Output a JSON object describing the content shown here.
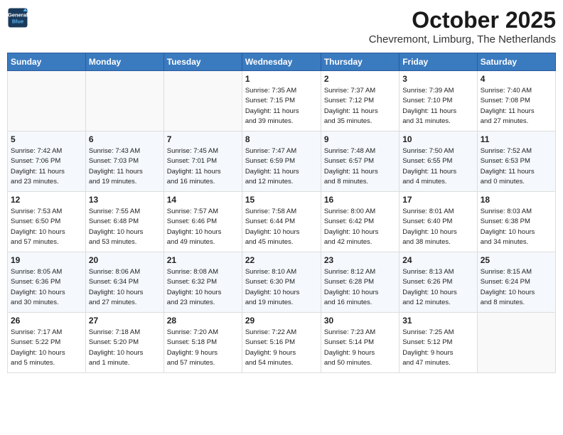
{
  "header": {
    "logo_line1": "General",
    "logo_line2": "Blue",
    "title": "October 2025",
    "subtitle": "Chevremont, Limburg, The Netherlands"
  },
  "weekdays": [
    "Sunday",
    "Monday",
    "Tuesday",
    "Wednesday",
    "Thursday",
    "Friday",
    "Saturday"
  ],
  "weeks": [
    [
      {
        "day": "",
        "info": ""
      },
      {
        "day": "",
        "info": ""
      },
      {
        "day": "",
        "info": ""
      },
      {
        "day": "1",
        "info": "Sunrise: 7:35 AM\nSunset: 7:15 PM\nDaylight: 11 hours\nand 39 minutes."
      },
      {
        "day": "2",
        "info": "Sunrise: 7:37 AM\nSunset: 7:12 PM\nDaylight: 11 hours\nand 35 minutes."
      },
      {
        "day": "3",
        "info": "Sunrise: 7:39 AM\nSunset: 7:10 PM\nDaylight: 11 hours\nand 31 minutes."
      },
      {
        "day": "4",
        "info": "Sunrise: 7:40 AM\nSunset: 7:08 PM\nDaylight: 11 hours\nand 27 minutes."
      }
    ],
    [
      {
        "day": "5",
        "info": "Sunrise: 7:42 AM\nSunset: 7:06 PM\nDaylight: 11 hours\nand 23 minutes."
      },
      {
        "day": "6",
        "info": "Sunrise: 7:43 AM\nSunset: 7:03 PM\nDaylight: 11 hours\nand 19 minutes."
      },
      {
        "day": "7",
        "info": "Sunrise: 7:45 AM\nSunset: 7:01 PM\nDaylight: 11 hours\nand 16 minutes."
      },
      {
        "day": "8",
        "info": "Sunrise: 7:47 AM\nSunset: 6:59 PM\nDaylight: 11 hours\nand 12 minutes."
      },
      {
        "day": "9",
        "info": "Sunrise: 7:48 AM\nSunset: 6:57 PM\nDaylight: 11 hours\nand 8 minutes."
      },
      {
        "day": "10",
        "info": "Sunrise: 7:50 AM\nSunset: 6:55 PM\nDaylight: 11 hours\nand 4 minutes."
      },
      {
        "day": "11",
        "info": "Sunrise: 7:52 AM\nSunset: 6:53 PM\nDaylight: 11 hours\nand 0 minutes."
      }
    ],
    [
      {
        "day": "12",
        "info": "Sunrise: 7:53 AM\nSunset: 6:50 PM\nDaylight: 10 hours\nand 57 minutes."
      },
      {
        "day": "13",
        "info": "Sunrise: 7:55 AM\nSunset: 6:48 PM\nDaylight: 10 hours\nand 53 minutes."
      },
      {
        "day": "14",
        "info": "Sunrise: 7:57 AM\nSunset: 6:46 PM\nDaylight: 10 hours\nand 49 minutes."
      },
      {
        "day": "15",
        "info": "Sunrise: 7:58 AM\nSunset: 6:44 PM\nDaylight: 10 hours\nand 45 minutes."
      },
      {
        "day": "16",
        "info": "Sunrise: 8:00 AM\nSunset: 6:42 PM\nDaylight: 10 hours\nand 42 minutes."
      },
      {
        "day": "17",
        "info": "Sunrise: 8:01 AM\nSunset: 6:40 PM\nDaylight: 10 hours\nand 38 minutes."
      },
      {
        "day": "18",
        "info": "Sunrise: 8:03 AM\nSunset: 6:38 PM\nDaylight: 10 hours\nand 34 minutes."
      }
    ],
    [
      {
        "day": "19",
        "info": "Sunrise: 8:05 AM\nSunset: 6:36 PM\nDaylight: 10 hours\nand 30 minutes."
      },
      {
        "day": "20",
        "info": "Sunrise: 8:06 AM\nSunset: 6:34 PM\nDaylight: 10 hours\nand 27 minutes."
      },
      {
        "day": "21",
        "info": "Sunrise: 8:08 AM\nSunset: 6:32 PM\nDaylight: 10 hours\nand 23 minutes."
      },
      {
        "day": "22",
        "info": "Sunrise: 8:10 AM\nSunset: 6:30 PM\nDaylight: 10 hours\nand 19 minutes."
      },
      {
        "day": "23",
        "info": "Sunrise: 8:12 AM\nSunset: 6:28 PM\nDaylight: 10 hours\nand 16 minutes."
      },
      {
        "day": "24",
        "info": "Sunrise: 8:13 AM\nSunset: 6:26 PM\nDaylight: 10 hours\nand 12 minutes."
      },
      {
        "day": "25",
        "info": "Sunrise: 8:15 AM\nSunset: 6:24 PM\nDaylight: 10 hours\nand 8 minutes."
      }
    ],
    [
      {
        "day": "26",
        "info": "Sunrise: 7:17 AM\nSunset: 5:22 PM\nDaylight: 10 hours\nand 5 minutes."
      },
      {
        "day": "27",
        "info": "Sunrise: 7:18 AM\nSunset: 5:20 PM\nDaylight: 10 hours\nand 1 minute."
      },
      {
        "day": "28",
        "info": "Sunrise: 7:20 AM\nSunset: 5:18 PM\nDaylight: 9 hours\nand 57 minutes."
      },
      {
        "day": "29",
        "info": "Sunrise: 7:22 AM\nSunset: 5:16 PM\nDaylight: 9 hours\nand 54 minutes."
      },
      {
        "day": "30",
        "info": "Sunrise: 7:23 AM\nSunset: 5:14 PM\nDaylight: 9 hours\nand 50 minutes."
      },
      {
        "day": "31",
        "info": "Sunrise: 7:25 AM\nSunset: 5:12 PM\nDaylight: 9 hours\nand 47 minutes."
      },
      {
        "day": "",
        "info": ""
      }
    ]
  ]
}
